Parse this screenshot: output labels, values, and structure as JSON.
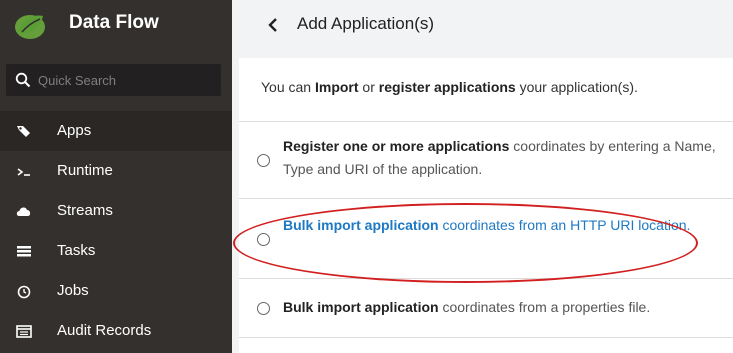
{
  "sidebar": {
    "brand_title": "Data Flow",
    "search_placeholder": "Quick Search",
    "items": [
      {
        "label": "Apps",
        "icon": "tag-icon",
        "active": true
      },
      {
        "label": "Runtime",
        "icon": "terminal-icon"
      },
      {
        "label": "Streams",
        "icon": "cloud-icon"
      },
      {
        "label": "Tasks",
        "icon": "tasks-icon"
      },
      {
        "label": "Jobs",
        "icon": "clock-icon"
      },
      {
        "label": "Audit Records",
        "icon": "audit-icon"
      }
    ]
  },
  "header": {
    "title": "Add Application(s)"
  },
  "intro": {
    "prefix": "You can ",
    "import_word": "Import",
    "middle": " or ",
    "register_word": "register applications",
    "suffix": " your application(s)."
  },
  "options": [
    {
      "bold": "Register one or more applications",
      "rest": " coordinates by entering a Name, Type and URI of the application."
    },
    {
      "bold": "Bulk import application",
      "rest": " coordinates from an HTTP URI location."
    },
    {
      "bold": "Bulk import application",
      "rest": " coordinates from a properties file."
    }
  ],
  "colors": {
    "sidebar_bg": "#34302d",
    "link": "#1e79c4",
    "highlight": "#d21f1f"
  }
}
